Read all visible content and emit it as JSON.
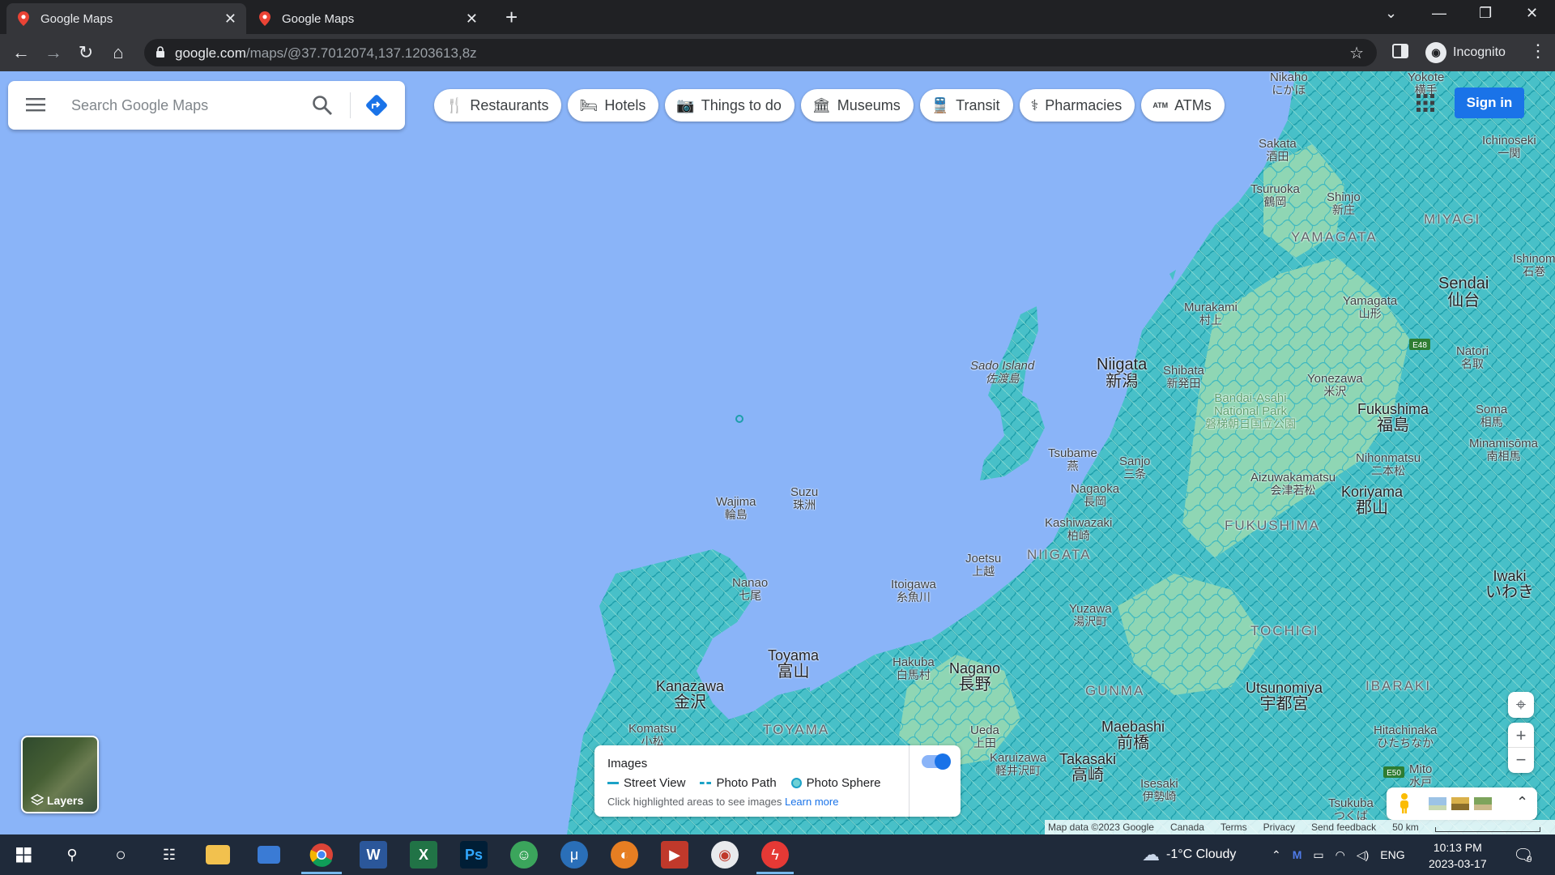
{
  "browser": {
    "tabs": [
      {
        "title": "Google Maps",
        "active": true
      },
      {
        "title": "Google Maps",
        "active": false
      }
    ],
    "url_host": "google.com",
    "url_path": "/maps/@37.7012074,137.1203613,8z",
    "profile_label": "Incognito"
  },
  "maps": {
    "search_placeholder": "Search Google Maps",
    "chips": [
      {
        "label": "Restaurants",
        "icon": "fork-knife-icon",
        "glyph": "🍴"
      },
      {
        "label": "Hotels",
        "icon": "bed-icon",
        "glyph": "🛏"
      },
      {
        "label": "Things to do",
        "icon": "camera-icon",
        "glyph": "📷"
      },
      {
        "label": "Museums",
        "icon": "museum-icon",
        "glyph": "🏛"
      },
      {
        "label": "Transit",
        "icon": "train-icon",
        "glyph": "🚆"
      },
      {
        "label": "Pharmacies",
        "icon": "pharmacy-icon",
        "glyph": "⚕"
      },
      {
        "label": "ATMs",
        "icon": "atm-icon",
        "glyph": "ATM"
      }
    ],
    "sign_in": "Sign in",
    "layers_label": "Layers",
    "legend": {
      "title": "Images",
      "street_view": "Street View",
      "photo_path": "Photo Path",
      "photo_sphere": "Photo Sphere",
      "hint": "Click highlighted areas to see images",
      "learn_more": "Learn more"
    },
    "footer": {
      "map_data": "Map data ©2023 Google",
      "region": "Canada",
      "terms": "Terms",
      "privacy": "Privacy",
      "feedback": "Send feedback",
      "scale": "50 km"
    },
    "places": [
      {
        "id": "niigata-city",
        "en": "Niigata",
        "jp": "新潟"
      },
      {
        "id": "sendai",
        "en": "Sendai",
        "jp": "仙台"
      },
      {
        "id": "fukushima-city",
        "en": "Fukushima",
        "jp": "福島"
      },
      {
        "id": "koriyama",
        "en": "Koriyama",
        "jp": "郡山"
      },
      {
        "id": "toyama-city",
        "en": "Toyama",
        "jp": "富山"
      },
      {
        "id": "kanazawa",
        "en": "Kanazawa",
        "jp": "金沢"
      },
      {
        "id": "nagano",
        "en": "Nagano",
        "jp": "長野"
      },
      {
        "id": "utsunomiya",
        "en": "Utsunomiya",
        "jp": "宇都宮"
      },
      {
        "id": "maebashi",
        "en": "Maebashi",
        "jp": "前橋"
      },
      {
        "id": "takasaki",
        "en": "Takasaki",
        "jp": "高崎"
      },
      {
        "id": "iwaki",
        "en": "Iwaki",
        "jp": "いわき"
      },
      {
        "id": "sado-island",
        "en": "Sado Island",
        "jp": "佐渡島"
      },
      {
        "id": "wajima",
        "en": "Wajima",
        "jp": "輪島"
      },
      {
        "id": "suzu",
        "en": "Suzu",
        "jp": "珠洲"
      },
      {
        "id": "nanao",
        "en": "Nanao",
        "jp": "七尾"
      },
      {
        "id": "joetsu",
        "en": "Joetsu",
        "jp": "上越"
      },
      {
        "id": "itoigawa",
        "en": "Itoigawa",
        "jp": "糸魚川"
      },
      {
        "id": "hakuba",
        "en": "Hakuba",
        "jp": "白馬村"
      },
      {
        "id": "shibata",
        "en": "Shibata",
        "jp": "新発田"
      },
      {
        "id": "murakami",
        "en": "Murakami",
        "jp": "村上"
      },
      {
        "id": "yamagata-city",
        "en": "Yamagata",
        "jp": "山形"
      },
      {
        "id": "sakata",
        "en": "Sakata",
        "jp": "酒田"
      },
      {
        "id": "tsuruoka",
        "en": "Tsuruoka",
        "jp": "鶴岡"
      },
      {
        "id": "shinjo",
        "en": "Shinjo",
        "jp": "新庄"
      },
      {
        "id": "natori",
        "en": "Natori",
        "jp": "名取"
      },
      {
        "id": "yonezawa",
        "en": "Yonezawa",
        "jp": "米沢"
      },
      {
        "id": "soma",
        "en": "Soma",
        "jp": "相馬"
      },
      {
        "id": "minamisoma",
        "en": "Minamisōma",
        "jp": "南相馬"
      },
      {
        "id": "nihonmatsu",
        "en": "Nihonmatsu",
        "jp": "二本松"
      },
      {
        "id": "aizuwakamatsu",
        "en": "Aizuwakamatsu",
        "jp": "会津若松"
      },
      {
        "id": "tsubame",
        "en": "Tsubame",
        "jp": "燕"
      },
      {
        "id": "sanjo",
        "en": "Sanjo",
        "jp": "三条"
      },
      {
        "id": "nagaoka",
        "en": "Nagaoka",
        "jp": "長岡"
      },
      {
        "id": "kashiwazaki",
        "en": "Kashiwazaki",
        "jp": "柏崎"
      },
      {
        "id": "yuzawa",
        "en": "Yuzawa",
        "jp": "湯沢町"
      },
      {
        "id": "ueda",
        "en": "Ueda",
        "jp": "上田"
      },
      {
        "id": "karuizawa",
        "en": "Karuizawa",
        "jp": "軽井沢町"
      },
      {
        "id": "isesaki",
        "en": "Isesaki",
        "jp": "伊勢崎"
      },
      {
        "id": "komatsu",
        "en": "Komatsu",
        "jp": "小松"
      },
      {
        "id": "hitachinaka",
        "en": "Hitachinaka",
        "jp": "ひたちなか"
      },
      {
        "id": "mito",
        "en": "Mito",
        "jp": "水戸"
      },
      {
        "id": "tsukuba",
        "en": "Tsukuba",
        "jp": "つくば"
      },
      {
        "id": "ichinoseki",
        "en": "Ichinoseki",
        "jp": "一関"
      },
      {
        "id": "nikaho",
        "en": "Nikaho",
        "jp": "にかほ"
      },
      {
        "id": "ishinomaki",
        "en": "Ishinom",
        "jp": "石巻"
      },
      {
        "id": "yokote",
        "en": "Yokote",
        "jp": "横手"
      },
      {
        "id": "bandai",
        "en": "Bandai-Asahi National Park",
        "jp": "磐梯朝日国立公園"
      }
    ],
    "prefectures": [
      "YAMAGATA",
      "MIYAGI",
      "FUKUSHIMA",
      "NIIGATA",
      "TOCHIGI",
      "GUNMA",
      "IBARAKI",
      "TOYAMA"
    ],
    "road_badges": [
      "E48",
      "E50"
    ],
    "water_color": "#8ab4f8",
    "land_color": "#b7e4c7",
    "overlay_color": "#2bb3c0"
  },
  "taskbar": {
    "weather": "-1°C  Cloudy",
    "language": "ENG",
    "time": "10:13 PM",
    "date": "2023-03-17",
    "notifications": "9"
  }
}
